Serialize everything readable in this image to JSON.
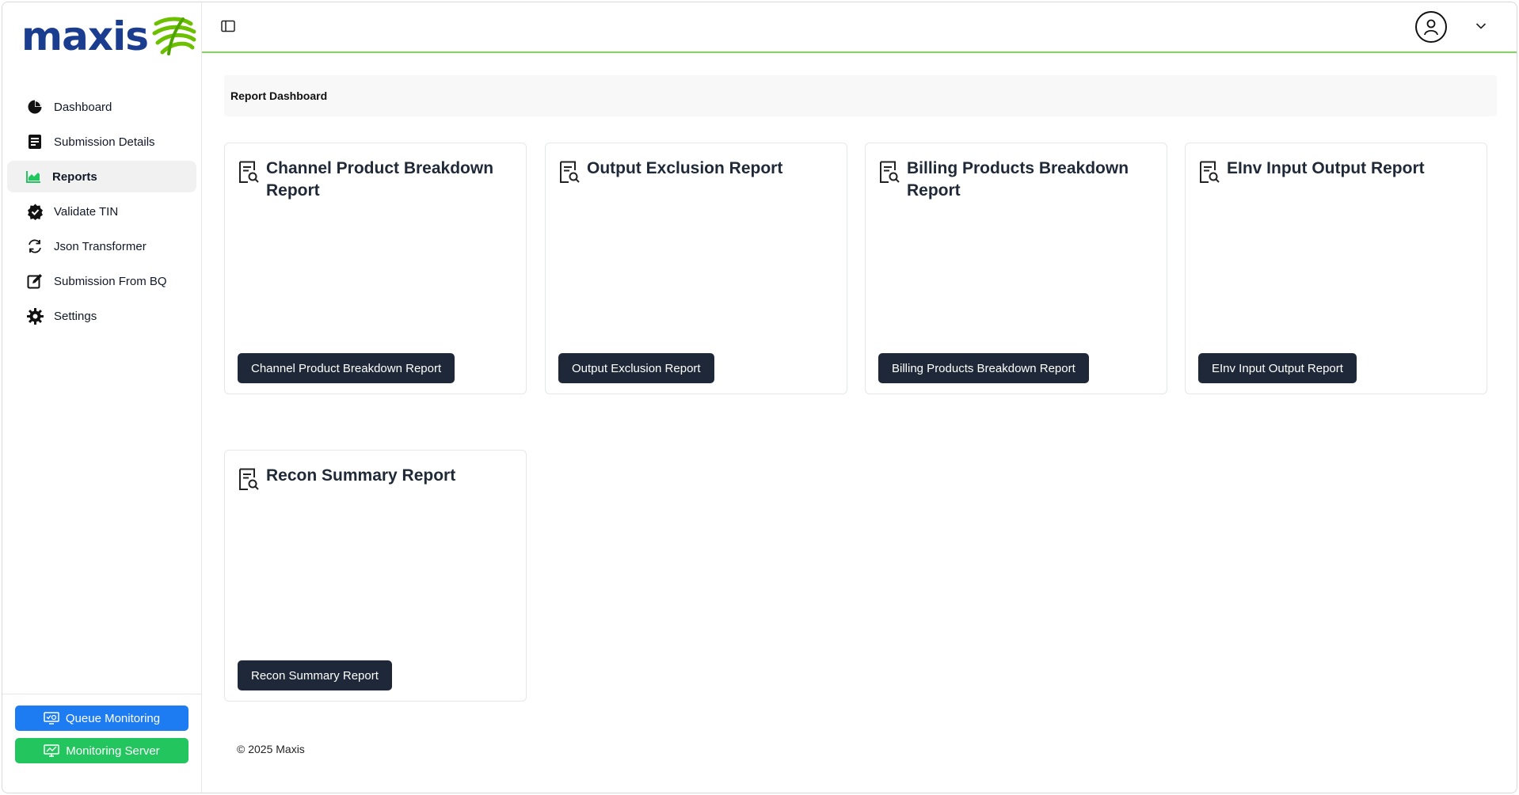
{
  "brand": {
    "name": "maxis",
    "colors": {
      "primary": "#1a3d8f",
      "accent": "#6cc000"
    }
  },
  "sidebar": {
    "items": [
      {
        "label": "Dashboard",
        "icon": "pie-chart-icon"
      },
      {
        "label": "Submission Details",
        "icon": "document-list-icon"
      },
      {
        "label": "Reports",
        "icon": "bar-chart-icon",
        "active": true
      },
      {
        "label": "Validate TIN",
        "icon": "verified-badge-icon"
      },
      {
        "label": "Json Transformer",
        "icon": "refresh-icon"
      },
      {
        "label": "Submission From BQ",
        "icon": "edit-icon"
      },
      {
        "label": "Settings",
        "icon": "gear-icon"
      }
    ],
    "bottom_buttons": [
      {
        "label": "Queue Monitoring",
        "icon": "monitor-check-icon",
        "color": "#1d7cf2"
      },
      {
        "label": "Monitoring Server",
        "icon": "monitor-chart-icon",
        "color": "#22c55e"
      }
    ]
  },
  "header": {
    "breadcrumb": "Report Dashboard"
  },
  "reports": [
    {
      "title": "Channel Product Breakdown Report",
      "button": "Channel Product Breakdown Report"
    },
    {
      "title": "Output Exclusion Report",
      "button": "Output Exclusion Report"
    },
    {
      "title": "Billing Products Breakdown Report",
      "button": "Billing Products Breakdown Report"
    },
    {
      "title": "EInv Input Output Report",
      "button": "EInv Input Output Report"
    },
    {
      "title": "Recon Summary Report",
      "button": "Recon Summary Report"
    }
  ],
  "footer": {
    "text": "© 2025 Maxis"
  }
}
